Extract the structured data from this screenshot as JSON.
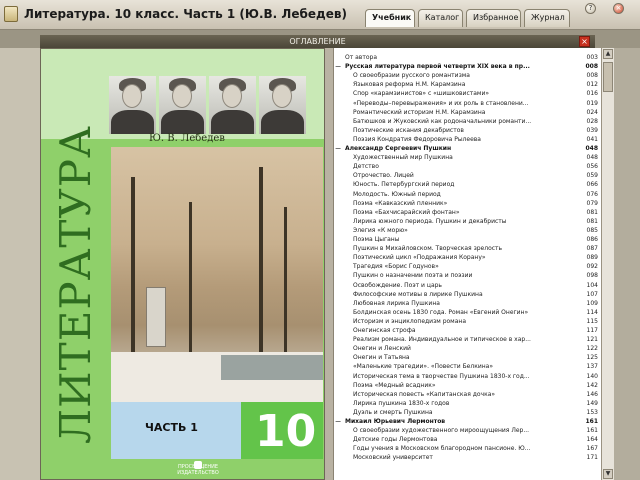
{
  "window": {
    "title": "Литература. 10 класс. Часть 1 (Ю.В. Лебедев)",
    "help_icon": "?",
    "close_icon": "×"
  },
  "tabs": [
    {
      "label": "Учебник",
      "active": true
    },
    {
      "label": "Каталог",
      "active": false
    },
    {
      "label": "Избранное",
      "active": false
    },
    {
      "label": "Журнал",
      "active": false
    }
  ],
  "toc_header": {
    "label": "ОГЛАВЛЕНИЕ",
    "close_icon": "×"
  },
  "cover": {
    "author": "Ю. В. Лебедев",
    "title": "ЛИТЕРАТУРА",
    "part": "ЧАСТЬ 1",
    "grade": "10",
    "publisher": "ПРОСВЕЩЕНИЕ ИЗДАТЕЛЬСТВО"
  },
  "toc": [
    {
      "title": "От автора",
      "page": "003",
      "level": 0,
      "bold": false,
      "marker": ""
    },
    {
      "title": "Русская литература первой четверти XIX века в пр...",
      "page": "008",
      "level": 0,
      "bold": true,
      "marker": "−"
    },
    {
      "title": "О своеобразии русского романтизма",
      "page": "008",
      "level": 1,
      "bold": false,
      "marker": ""
    },
    {
      "title": "Языковая реформа Н.М. Карамзина",
      "page": "012",
      "level": 1,
      "bold": false,
      "marker": ""
    },
    {
      "title": "Спор «карамзинистов» с «шишковистами»",
      "page": "016",
      "level": 1,
      "bold": false,
      "marker": ""
    },
    {
      "title": "«Переводы–перевыражения» и их роль в становлени...",
      "page": "019",
      "level": 1,
      "bold": false,
      "marker": ""
    },
    {
      "title": "Романтический историзм Н.М. Карамзина",
      "page": "024",
      "level": 1,
      "bold": false,
      "marker": ""
    },
    {
      "title": "Батюшков и Жуковский как родоначальники романти...",
      "page": "028",
      "level": 1,
      "bold": false,
      "marker": ""
    },
    {
      "title": "Поэтические искания декабристов",
      "page": "039",
      "level": 1,
      "bold": false,
      "marker": ""
    },
    {
      "title": "Поэзия Кондратия Федоровича Рылеева",
      "page": "041",
      "level": 1,
      "bold": false,
      "marker": ""
    },
    {
      "title": "Александр Сергеевич Пушкин",
      "page": "048",
      "level": 0,
      "bold": true,
      "marker": "−"
    },
    {
      "title": "Художественный мир Пушкина",
      "page": "048",
      "level": 1,
      "bold": false,
      "marker": ""
    },
    {
      "title": "Детство",
      "page": "056",
      "level": 1,
      "bold": false,
      "marker": ""
    },
    {
      "title": "Отрочество. Лицей",
      "page": "059",
      "level": 1,
      "bold": false,
      "marker": ""
    },
    {
      "title": "Юность. Петербургский период",
      "page": "066",
      "level": 1,
      "bold": false,
      "marker": ""
    },
    {
      "title": "Молодость. Южный период",
      "page": "076",
      "level": 1,
      "bold": false,
      "marker": ""
    },
    {
      "title": "Поэма «Кавказский пленник»",
      "page": "079",
      "level": 1,
      "bold": false,
      "marker": ""
    },
    {
      "title": "Поэма «Бахчисарайский фонтан»",
      "page": "081",
      "level": 1,
      "bold": false,
      "marker": ""
    },
    {
      "title": "Лирика южного периода. Пушкин и декабристы",
      "page": "081",
      "level": 1,
      "bold": false,
      "marker": ""
    },
    {
      "title": "Элегия «К морю»",
      "page": "085",
      "level": 1,
      "bold": false,
      "marker": ""
    },
    {
      "title": "Поэма Цыганы",
      "page": "086",
      "level": 1,
      "bold": false,
      "marker": ""
    },
    {
      "title": "Пушкин в Михайловском. Творческая зрелость",
      "page": "087",
      "level": 1,
      "bold": false,
      "marker": ""
    },
    {
      "title": "Поэтический цикл «Подражания Корану»",
      "page": "089",
      "level": 1,
      "bold": false,
      "marker": ""
    },
    {
      "title": "Трагедия «Борис Годунов»",
      "page": "092",
      "level": 1,
      "bold": false,
      "marker": ""
    },
    {
      "title": "Пушкин о назначении поэта и поэзии",
      "page": "098",
      "level": 1,
      "bold": false,
      "marker": ""
    },
    {
      "title": "Освобождение. Поэт и царь",
      "page": "104",
      "level": 1,
      "bold": false,
      "marker": ""
    },
    {
      "title": "Философские мотивы в лирике Пушкина",
      "page": "107",
      "level": 1,
      "bold": false,
      "marker": ""
    },
    {
      "title": "Любовная лирика Пушкина",
      "page": "109",
      "level": 1,
      "bold": false,
      "marker": ""
    },
    {
      "title": "Болдинская осень 1830 года. Роман «Евгений Онегин»",
      "page": "114",
      "level": 1,
      "bold": false,
      "marker": ""
    },
    {
      "title": "Историзм и энциклопедизм романа",
      "page": "115",
      "level": 1,
      "bold": false,
      "marker": ""
    },
    {
      "title": "Онегинская строфа",
      "page": "117",
      "level": 1,
      "bold": false,
      "marker": ""
    },
    {
      "title": "Реализм романа. Индивидуальное и типическое в хар...",
      "page": "121",
      "level": 1,
      "bold": false,
      "marker": ""
    },
    {
      "title": "Онегин и Ленский",
      "page": "122",
      "level": 1,
      "bold": false,
      "marker": ""
    },
    {
      "title": "Онегин и Татьяна",
      "page": "125",
      "level": 1,
      "bold": false,
      "marker": ""
    },
    {
      "title": "«Маленькие трагедии». «Повести Белкина»",
      "page": "137",
      "level": 1,
      "bold": false,
      "marker": ""
    },
    {
      "title": "Историческая тема в творчестве Пушкина 1830-х год...",
      "page": "140",
      "level": 1,
      "bold": false,
      "marker": ""
    },
    {
      "title": "Поэма «Медный всадник»",
      "page": "142",
      "level": 1,
      "bold": false,
      "marker": ""
    },
    {
      "title": "Историческая повесть «Капитанская дочка»",
      "page": "146",
      "level": 1,
      "bold": false,
      "marker": ""
    },
    {
      "title": "Лирика пушкина 1830-х годов",
      "page": "149",
      "level": 1,
      "bold": false,
      "marker": ""
    },
    {
      "title": "Дуэль и смерть Пушкина",
      "page": "153",
      "level": 1,
      "bold": false,
      "marker": ""
    },
    {
      "title": "Михаил Юрьевич Лермонтов",
      "page": "161",
      "level": 0,
      "bold": true,
      "marker": "−"
    },
    {
      "title": "О своеобразии художественного мироощущения Лер...",
      "page": "161",
      "level": 1,
      "bold": false,
      "marker": ""
    },
    {
      "title": "Детские годы Лермонтова",
      "page": "164",
      "level": 1,
      "bold": false,
      "marker": ""
    },
    {
      "title": "Годы учения в Московском благородном пансионе. Ю...",
      "page": "167",
      "level": 1,
      "bold": false,
      "marker": ""
    },
    {
      "title": "Московский университет",
      "page": "171",
      "level": 1,
      "bold": false,
      "marker": ""
    }
  ],
  "scrollbar": {
    "up_icon": "▲",
    "down_icon": "▼"
  },
  "colors": {
    "title_bar": "#c9c1b1",
    "accent_green": "#63c44a",
    "toc_header": "#4b4638"
  }
}
